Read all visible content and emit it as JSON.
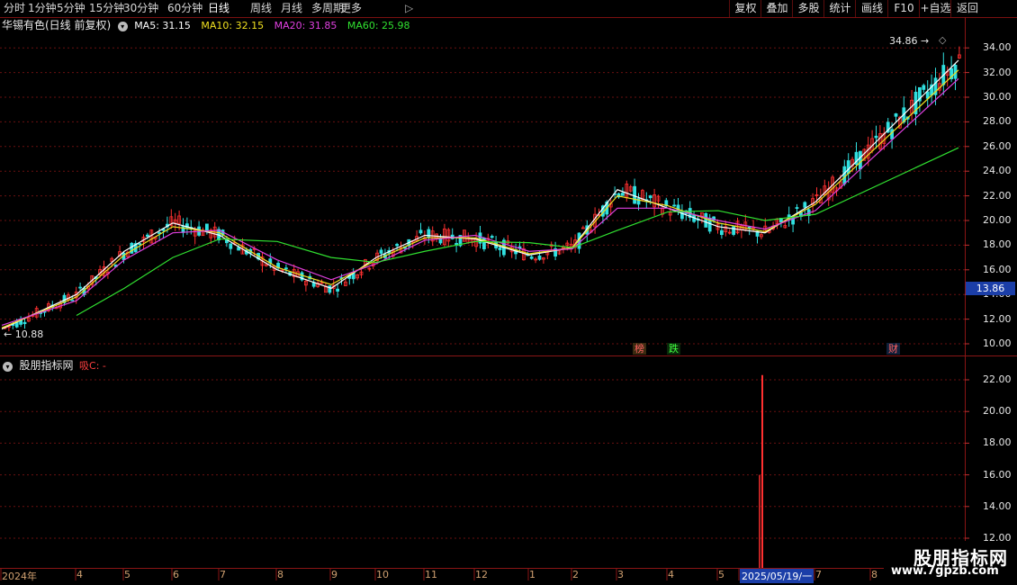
{
  "toolbar": {
    "left_items": [
      "分时",
      "1分钟",
      "5分钟",
      "15分钟",
      "30分钟",
      "60分钟",
      "日线",
      "周线",
      "月线",
      "多周期",
      "更多"
    ],
    "active": "日线",
    "right_buttons": [
      "复权",
      "叠加",
      "多股",
      "统计",
      "画线",
      "F10",
      "+自选",
      "返回"
    ]
  },
  "stock": {
    "name": "华锡有色(日线 前复权)",
    "ma5": "MA5: 31.15",
    "ma10": "MA10: 32.15",
    "ma20": "MA20: 31.85",
    "ma60": "MA60: 25.98",
    "ma5_color": "#ffffff",
    "ma10_color": "#f0e020",
    "ma20_color": "#e040e0",
    "ma60_color": "#30e030"
  },
  "price_axis": {
    "ticks": [
      "34.00",
      "32.00",
      "30.00",
      "28.00",
      "26.00",
      "24.00",
      "22.00",
      "20.00",
      "18.00",
      "16.00",
      "14.00",
      "12.00",
      "10.00"
    ],
    "current_price": "13.86",
    "high_label": "34.86",
    "low_label": "10.88"
  },
  "event_tags": [
    {
      "text": "榜",
      "color": "#ff6060"
    },
    {
      "text": "跌",
      "color": "#40ff40"
    },
    {
      "text": "财",
      "color": "#ff6060"
    }
  ],
  "indicator": {
    "name": "股朋指标网",
    "formula": "吸C: -",
    "ticks": [
      "22.00",
      "20.00",
      "18.00",
      "16.00",
      "14.00",
      "12.00"
    ]
  },
  "date_axis": {
    "labels": [
      "2024年",
      "4",
      "5",
      "6",
      "7",
      "8",
      "9",
      "10",
      "11",
      "12",
      "1",
      "2",
      "3",
      "4",
      "5",
      "2025/05/19/一",
      "7",
      "8"
    ],
    "highlight": "2025/05/19/一"
  },
  "watermark": {
    "title": "股朋指标网",
    "url": "www.7gpzb.com"
  },
  "chart_data": {
    "type": "line",
    "title": "华锡有色(日线 前复权)",
    "xlabel": "",
    "ylabel": "",
    "ylim": [
      10,
      35
    ],
    "x": [
      "2024-03",
      "2024-04",
      "2024-05",
      "2024-06",
      "2024-07",
      "2024-08",
      "2024-09",
      "2024-10",
      "2024-11",
      "2024-12",
      "2025-01",
      "2025-02",
      "2025-03",
      "2025-04",
      "2025-05",
      "2025-06",
      "2025-07",
      "2025-08"
    ],
    "series": [
      {
        "name": "MA5",
        "values": [
          11.2,
          14.0,
          17.5,
          19.8,
          18.8,
          16.0,
          14.5,
          17.0,
          18.8,
          18.5,
          17.2,
          17.8,
          22.5,
          21.0,
          19.5,
          19.0,
          21.5,
          33.0
        ]
      },
      {
        "name": "MA10",
        "values": [
          11.3,
          13.8,
          17.2,
          19.5,
          19.0,
          16.2,
          14.8,
          16.8,
          18.6,
          18.6,
          17.3,
          17.8,
          22.0,
          21.2,
          19.8,
          19.1,
          21.3,
          32.2
        ]
      },
      {
        "name": "MA20",
        "values": [
          11.5,
          13.5,
          16.8,
          19.0,
          19.2,
          16.8,
          15.2,
          16.5,
          18.4,
          18.8,
          17.5,
          17.7,
          21.0,
          21.0,
          20.0,
          19.3,
          20.8,
          31.5
        ]
      },
      {
        "name": "MA60",
        "values": [
          null,
          12.3,
          14.5,
          17.0,
          18.5,
          18.3,
          17.0,
          16.6,
          17.5,
          18.3,
          18.2,
          17.8,
          19.2,
          20.7,
          20.8,
          20.0,
          20.5,
          25.9
        ]
      }
    ],
    "indicator_series": {
      "x": [
        "2025/05/19/一"
      ],
      "values": [
        22.3
      ]
    },
    "indicator_ylim": [
      11,
      23
    ]
  }
}
